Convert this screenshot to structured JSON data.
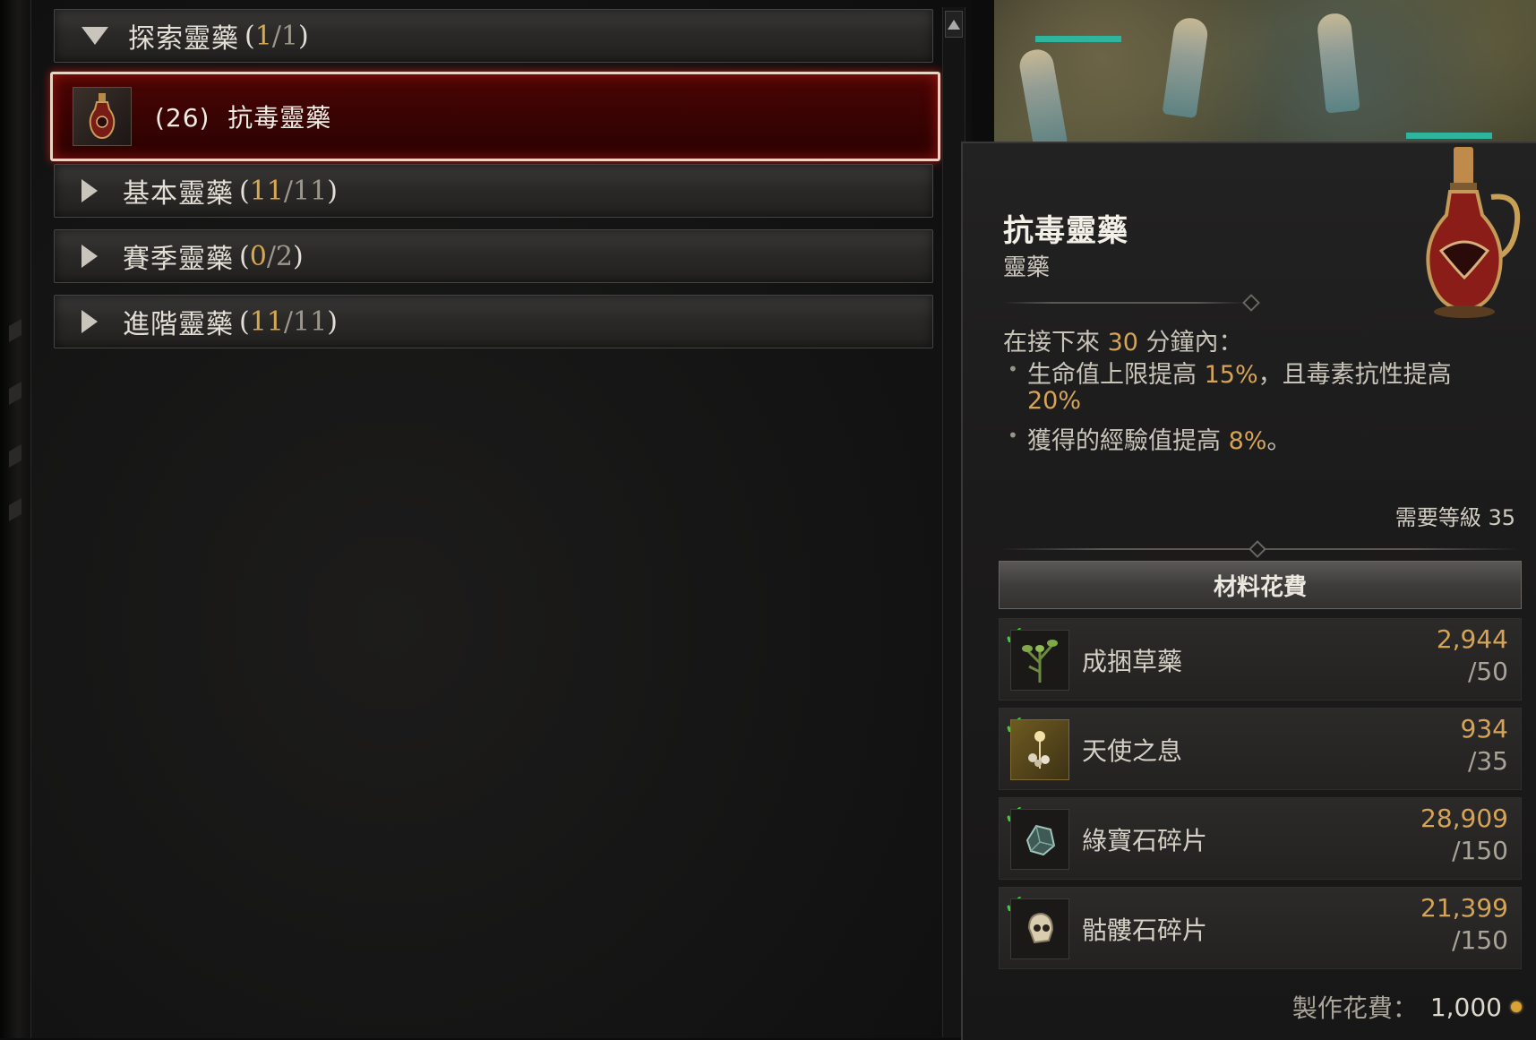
{
  "categories": [
    {
      "label": "探索靈藥",
      "paren_open": "(",
      "have": "1",
      "sep": "/",
      "total": "1",
      "paren_close": ")",
      "expanded": true
    },
    {
      "label": "基本靈藥",
      "paren_open": "(",
      "have": "11",
      "sep": "/",
      "total": "11",
      "paren_close": ")",
      "expanded": false
    },
    {
      "label": "賽季靈藥",
      "paren_open": "(",
      "have": "0",
      "sep": "/",
      "total": "2",
      "paren_close": ")",
      "expanded": false
    },
    {
      "label": "進階靈藥",
      "paren_open": "(",
      "have": "11",
      "sep": "/",
      "total": "11",
      "paren_close": ")",
      "expanded": false
    }
  ],
  "selected_item": {
    "quantity": "(26)",
    "name": "抗毒靈藥",
    "icon": "elixir-flask-icon"
  },
  "tooltip": {
    "title": "抗毒靈藥",
    "subtitle": "靈藥",
    "duration_prefix": "在接下來",
    "duration_value": "30",
    "duration_suffix": "分鐘內：",
    "line1_prefix": "生命值上限提高",
    "line1_value": "15%",
    "line1_mid": "，且毒素抗性提高",
    "line1_value2": "20%",
    "line2_prefix": "獲得的經驗值提高",
    "line2_value": "8%",
    "line2_suffix": "。",
    "required_level": "需要等級 35",
    "materials_header": "材料花費",
    "materials": [
      {
        "name": "成捆草藥",
        "have": "2,944",
        "need": "/50",
        "icon": "herb-bundle-icon"
      },
      {
        "name": "天使之息",
        "have": "934",
        "need": "/35",
        "icon": "angel-breath-icon"
      },
      {
        "name": "綠寶石碎片",
        "have": "28,909",
        "need": "/150",
        "icon": "emerald-shard-icon"
      },
      {
        "name": "骷髏石碎片",
        "have": "21,399",
        "need": "/150",
        "icon": "skull-shard-icon"
      }
    ],
    "craft_cost_label": "製作花費：",
    "craft_cost_value": "1,000",
    "craft_cost_icon": "gold-coin-icon"
  },
  "colors": {
    "accent_gold": "#d6a457",
    "check_green": "#3ecf3a",
    "selected_red": "#3a0303"
  }
}
